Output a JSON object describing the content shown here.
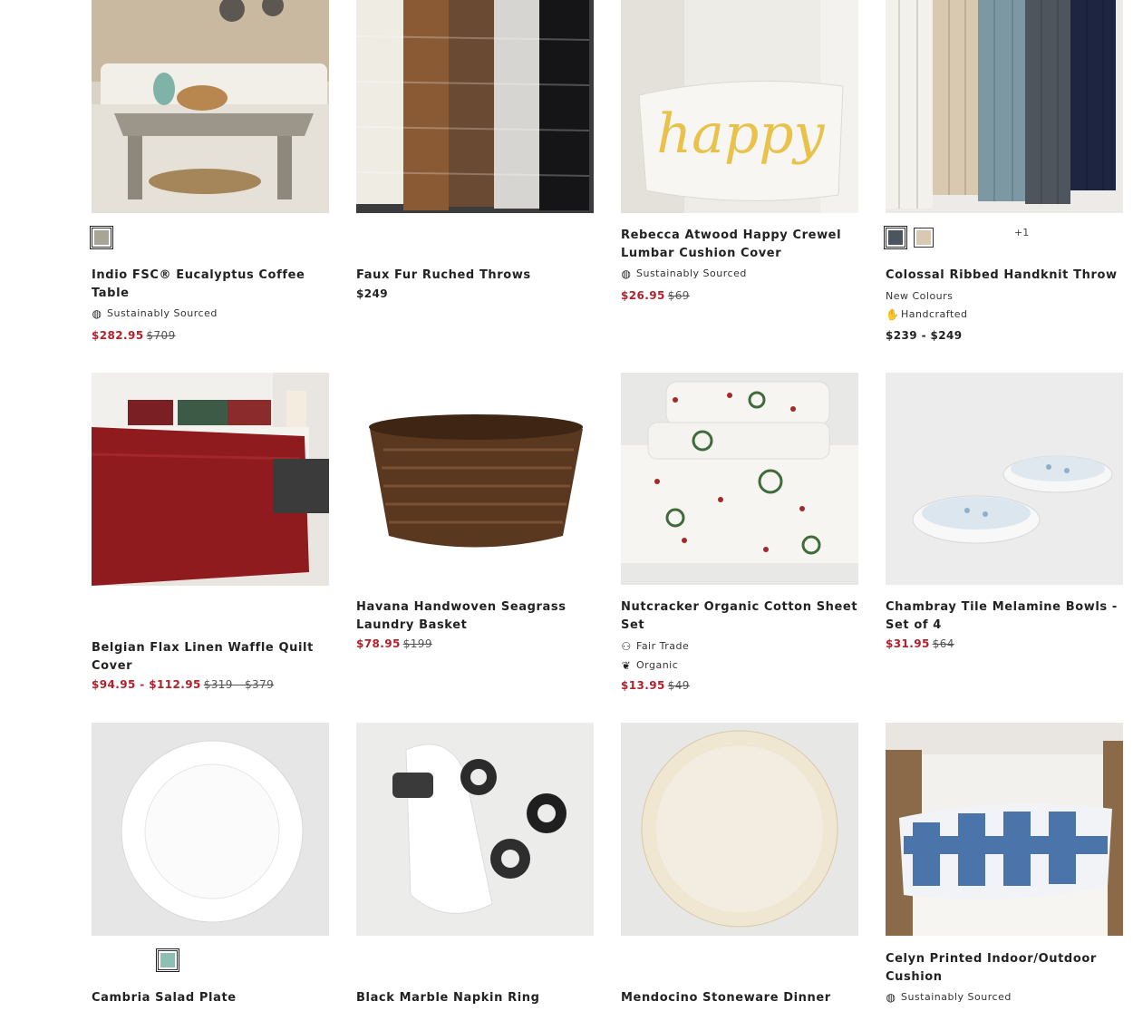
{
  "colors": {
    "sale": "#b3202b",
    "text": "#222222"
  },
  "products": [
    {
      "name": "Indio FSC® Eucalyptus Coffee Table",
      "image": "outdoor coffee table with sofa",
      "swatches": [
        "#a8a496"
      ],
      "attributes": [
        {
          "icon": "globe-icon",
          "label": "Sustainably Sourced"
        }
      ],
      "sale_price": "$282.95",
      "original_price": "$709"
    },
    {
      "name": "Faux Fur Ruched Throws",
      "image": "faux fur throws hanging",
      "price": "$249"
    },
    {
      "name": "Rebecca Atwood Happy Crewel Lumbar Cushion Cover",
      "image": "white cushion with yellow happy text",
      "attributes": [
        {
          "icon": "globe-icon",
          "label": "Sustainably Sourced"
        }
      ],
      "sale_price": "$26.95",
      "original_price": "$69"
    },
    {
      "name": "Colossal Ribbed Handknit Throw",
      "image": "knit throws in several colours",
      "swatches": [
        "#4a5560",
        "#d9c9b3"
      ],
      "more": "+1",
      "subtitle": "New Colours",
      "attributes": [
        {
          "icon": "hand-icon",
          "label": "Handcrafted"
        }
      ],
      "price": "$239 - $249"
    },
    {
      "name": "Belgian Flax Linen Waffle Quilt Cover",
      "image": "red quilt on bed",
      "sale_price": "$94.95 - $112.95",
      "original_price": "$319 - $379"
    },
    {
      "name": "Havana Handwoven Seagrass Laundry Basket",
      "image": "woven seagrass basket",
      "sale_price": "$78.95",
      "original_price": "$199"
    },
    {
      "name": "Nutcracker Organic Cotton Sheet Set",
      "image": "holiday print sheets",
      "attributes": [
        {
          "icon": "fair-trade-icon",
          "label": "Fair Trade"
        },
        {
          "icon": "leaf-icon",
          "label": "Organic"
        }
      ],
      "sale_price": "$13.95",
      "original_price": "$49"
    },
    {
      "name": "Chambray Tile Melamine Bowls - Set of 4",
      "image": "blue and white bowls",
      "sale_price": "$31.95",
      "original_price": "$64"
    },
    {
      "name": "Cambria Salad Plate",
      "image": "white salad plate",
      "swatches": [
        "#8dbfb5"
      ]
    },
    {
      "name": "Black Marble Napkin Ring",
      "image": "black marble napkin rings with napkin"
    },
    {
      "name": "Mendocino Stoneware Dinner",
      "image": "cream stoneware plate"
    },
    {
      "name": "Celyn Printed Indoor/Outdoor Cushion",
      "image": "blue tie-dye lumbar cushion on wicker chair",
      "attributes": [
        {
          "icon": "globe-icon",
          "label": "Sustainably Sourced"
        }
      ]
    }
  ]
}
